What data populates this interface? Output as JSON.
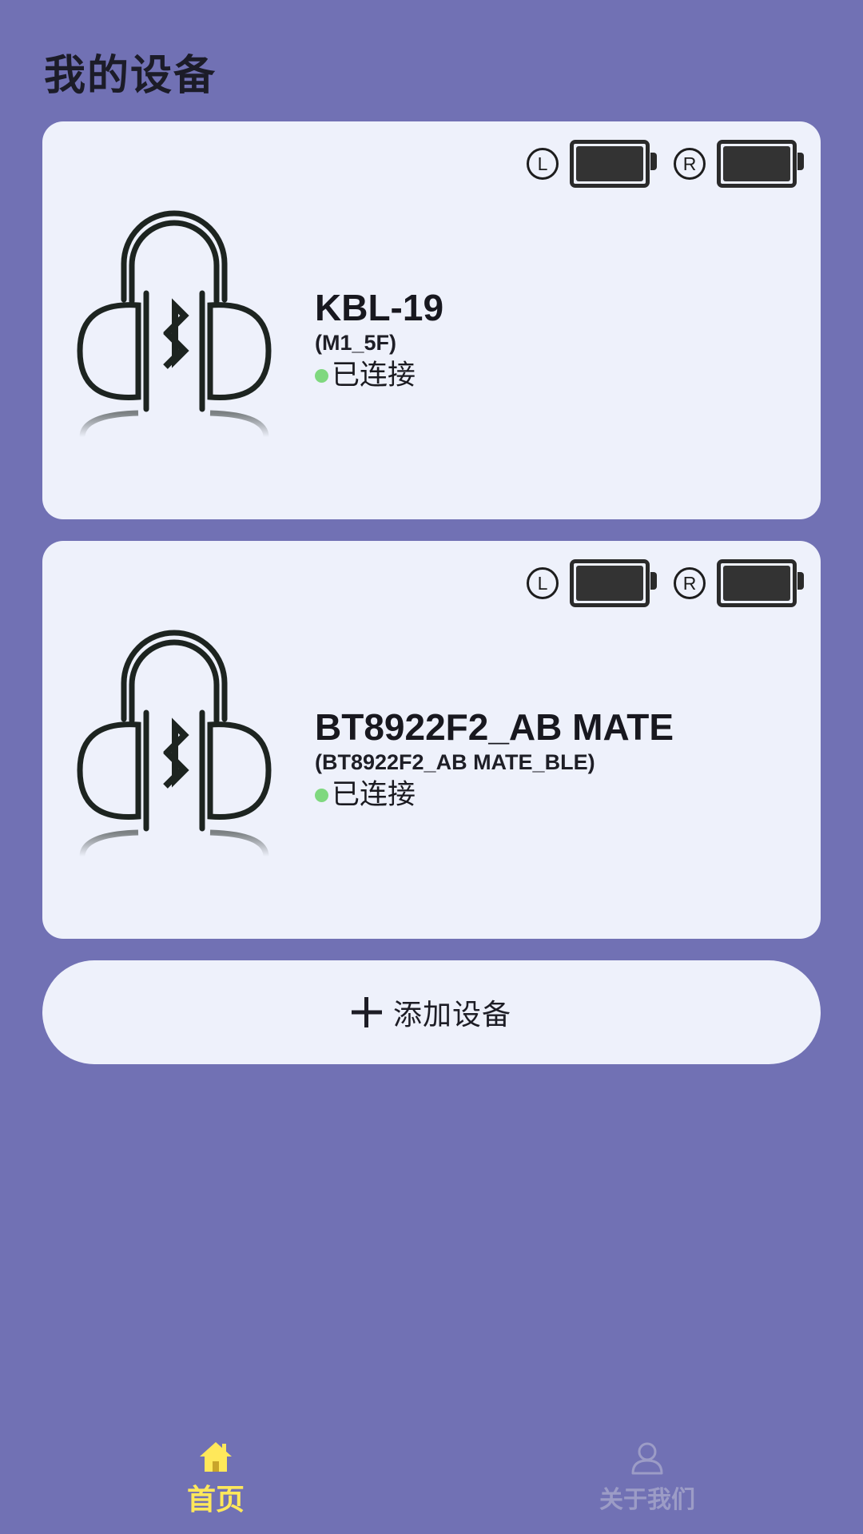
{
  "header": {
    "title": "我的设备"
  },
  "devices": [
    {
      "name": "KBL-19",
      "subtitle": "(M1_5F)",
      "status": "已连接",
      "battery_left": {
        "label": "L",
        "level": 1.0
      },
      "battery_right": {
        "label": "R",
        "level": 1.0
      }
    },
    {
      "name": "BT8922F2_AB MATE",
      "subtitle": "(BT8922F2_AB MATE_BLE)",
      "status": "已连接",
      "battery_left": {
        "label": "L",
        "level": 1.0
      },
      "battery_right": {
        "label": "R",
        "level": 1.0
      }
    }
  ],
  "add_device": {
    "label": "添加设备",
    "icon": "plus-icon"
  },
  "bottom_nav": {
    "items": [
      {
        "label": "首页",
        "icon": "home-icon",
        "active": true
      },
      {
        "label": "关于我们",
        "icon": "person-icon",
        "active": false
      }
    ]
  },
  "colors": {
    "background": "#7171b4",
    "card": "#eef1fb",
    "status_connected": "#7fd87f",
    "nav_active": "#ffe85a",
    "nav_inactive": "#9c9cc6"
  }
}
